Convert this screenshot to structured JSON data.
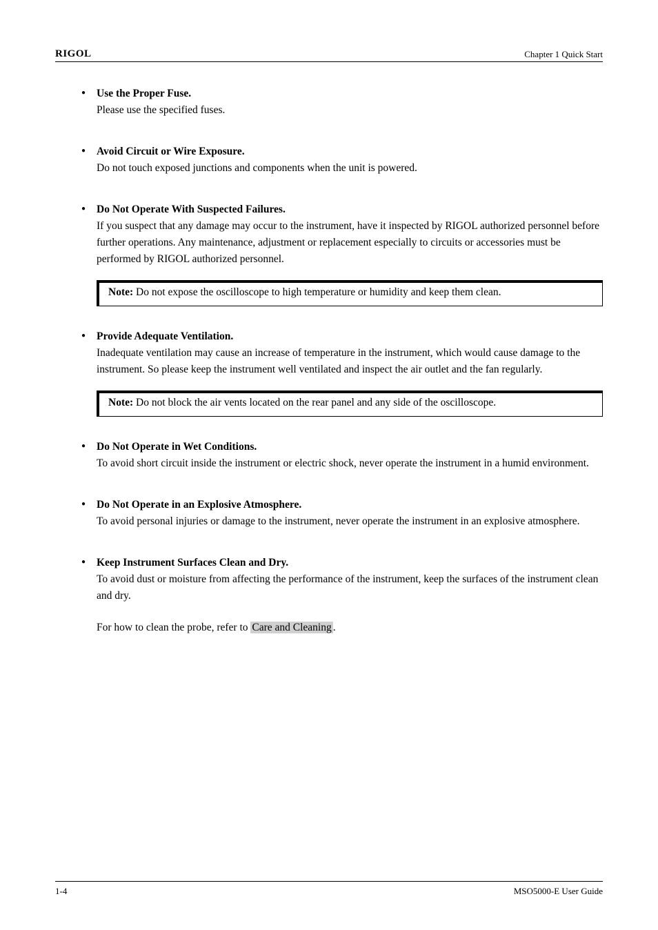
{
  "header": {
    "brand": "RIGOL",
    "chapter": "Chapter 1 Quick Start"
  },
  "items": [
    {
      "title": "Use the Proper Fuse.",
      "text": "Please use the specified fuses."
    },
    {
      "title": "Avoid Circuit or Wire Exposure.",
      "text": "Do not touch exposed junctions and components when the unit is powered."
    },
    {
      "title": "Do Not Operate With Suspected Failures.",
      "text": "If you suspect that any damage may occur to the instrument, have it inspected by RIGOL authorized personnel before further operations. Any maintenance, adjustment or replacement especially to circuits or accessories must be performed by RIGOL authorized personnel.",
      "note": {
        "label": "Note:",
        "body": " Do not expose the oscilloscope to high temperature or humidity and keep them clean."
      }
    },
    {
      "title": "Provide Adequate Ventilation.",
      "text": "Inadequate ventilation may cause an increase of temperature in the instrument, which would cause damage to the instrument. So please keep the instrument well ventilated and inspect the air outlet and the fan regularly.",
      "note": {
        "label": "Note:",
        "body": " Do not block the air vents located on the rear panel and any side of the oscilloscope."
      }
    },
    {
      "title": "Do Not Operate in Wet Conditions.",
      "text": "To avoid short circuit inside the instrument or electric shock, never operate the instrument in a humid environment."
    },
    {
      "title": "Do Not Operate in an Explosive Atmosphere.",
      "text": "To avoid personal injuries or damage to the instrument, never operate the instrument in an explosive atmosphere."
    },
    {
      "title": "Keep Instrument Surfaces Clean and Dry.",
      "text_parts": {
        "p1": "To avoid dust or moisture from affecting the performance of the instrument, keep the surfaces of the instrument clean and dry.",
        "p2_pre": "For how to clean the probe, refer to ",
        "p2_link": "Care and Cleaning",
        "p2_post": "."
      }
    }
  ],
  "footer": {
    "page": "1-4",
    "doc": "MSO5000-E User Guide"
  }
}
